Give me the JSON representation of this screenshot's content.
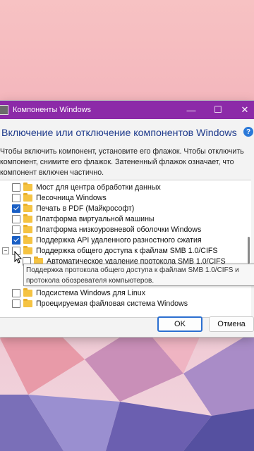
{
  "window": {
    "title": "Компоненты Windows",
    "controls": {
      "minimize": "—",
      "maximize": "☐",
      "close": "✕"
    }
  },
  "heading": "Включение или отключение компонентов Windows",
  "help_icon": "?",
  "description": "Чтобы включить компонент, установите его флажок. Чтобы отключить компонент, снимите его флажок. Затененный флажок означает, что компонент включен частично.",
  "features": [
    {
      "label": "Мост для центра обработки данных",
      "checked": false
    },
    {
      "label": "Песочница Windows",
      "checked": false
    },
    {
      "label": "Печать в PDF (Майкрософт)",
      "checked": true
    },
    {
      "label": "Платформа виртуальной машины",
      "checked": false
    },
    {
      "label": "Платформа низкоуровневой оболочки Windows",
      "checked": false
    },
    {
      "label": "Поддержка API удаленного разностного сжатия",
      "checked": true
    },
    {
      "label": "Поддержка общего доступа к файлам SMB 1.0/CIFS",
      "checked": false,
      "expanded": true
    },
    {
      "label": "Автоматическое удаление протокола SMB 1.0/CIFS",
      "checked": false,
      "child": true
    },
    {
      "label": "Подсистема Windows для Linux",
      "checked": false
    },
    {
      "label": "Проецируемая файловая система Windows",
      "checked": false
    }
  ],
  "expander_symbol": "−",
  "tooltip": "Поддержка протокола общего доступа к файлам SMB 1.0/CIFS и протокола обозревателя компьютеров.",
  "buttons": {
    "ok": "OK",
    "cancel": "Отмена"
  },
  "colors": {
    "titlebar": "#8c2aa8",
    "heading": "#1f3b8c",
    "accent": "#1a5fc4"
  }
}
